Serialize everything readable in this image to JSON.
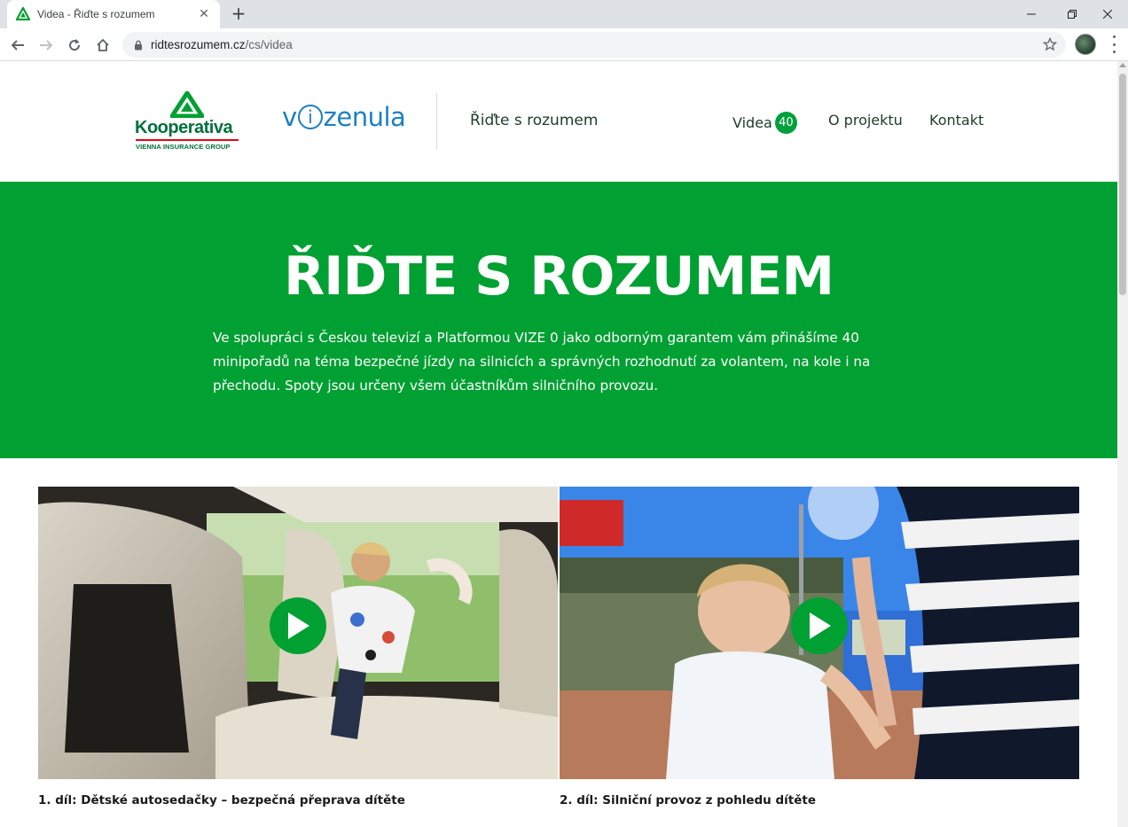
{
  "browser": {
    "tab_title": "Videa - Řiďte s rozumem",
    "url_host": "ridtesrozumem.cz",
    "url_path": "/cs/videa",
    "icons": [
      "back-icon",
      "forward-icon",
      "reload-icon",
      "home-icon",
      "lock-icon",
      "star-icon",
      "profile-avatar",
      "menu-icon"
    ]
  },
  "header": {
    "kooperativa_name": "Kooperativa",
    "kooperativa_sub": "VIENNA INSURANCE GROUP",
    "vize_pre": "v",
    "vize_i": "i",
    "vize_post": "zenula",
    "site_title": "Řiďte s rozumem",
    "nav": {
      "videa_label": "Videa",
      "videa_count": "40",
      "projekt_label": "O projektu",
      "kontakt_label": "Kontakt"
    }
  },
  "hero": {
    "title": "ŘIĎTE S ROZUMEM",
    "text": "Ve spolupráci s Českou televizí a Platformou VIZE 0 jako odborným garantem vám přinášíme 40 minipořadů na téma bezpečné jízdy na silnicích a správných rozhodnutí za volantem, na kole i na přechodu. Spoty jsou určeny všem účastníkům silničního provozu."
  },
  "videos": [
    {
      "title": "1. díl: Dětské autosedačky – bezpečná přeprava dítěte"
    },
    {
      "title": "2. díl: Silniční provoz z pohledu dítěte"
    }
  ],
  "colors": {
    "brand_green": "#00a032",
    "kooperativa_green": "#00703c",
    "vize_blue": "#1e7fc3"
  }
}
